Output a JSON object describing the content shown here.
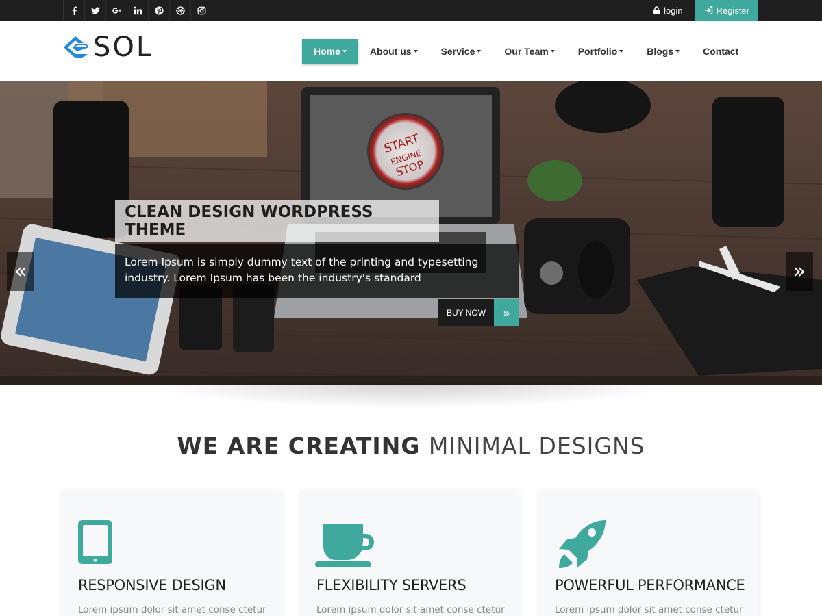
{
  "colors": {
    "accent": "#40a99d",
    "topbar": "#1f1f1f",
    "logo_blue": "#1e88e5"
  },
  "topbar": {
    "social": [
      {
        "name": "facebook-icon",
        "glyph": "f"
      },
      {
        "name": "twitter-icon",
        "glyph": "t"
      },
      {
        "name": "google-plus-icon",
        "glyph": "G+"
      },
      {
        "name": "linkedin-icon",
        "glyph": "in"
      },
      {
        "name": "pinterest-icon",
        "glyph": "p"
      },
      {
        "name": "dribbble-icon",
        "glyph": "d"
      },
      {
        "name": "instagram-icon",
        "glyph": "ig"
      }
    ],
    "login_label": "login",
    "register_label": "Register"
  },
  "header": {
    "logo_text": "SOL",
    "nav": [
      {
        "label": "Home",
        "dropdown": true,
        "active": true
      },
      {
        "label": "About us",
        "dropdown": true,
        "active": false
      },
      {
        "label": "Service",
        "dropdown": true,
        "active": false
      },
      {
        "label": "Our Team",
        "dropdown": true,
        "active": false
      },
      {
        "label": "Portfolio",
        "dropdown": true,
        "active": false
      },
      {
        "label": "Blogs",
        "dropdown": true,
        "active": false
      },
      {
        "label": "Contact",
        "dropdown": false,
        "active": false
      }
    ]
  },
  "hero": {
    "title": "CLEAN DESIGN WORDPRESS THEME",
    "text": "Lorem Ipsum is simply dummy text of the printing and typesetting industry. Lorem Ipsum has been the industry's standard",
    "button_label": "BUY NOW",
    "screen_text_1": "START",
    "screen_text_2": "ENGINE",
    "screen_text_3": "STOP"
  },
  "section": {
    "title_bold": "WE ARE CREATING",
    "title_light": "MINIMAL DESIGNS"
  },
  "features": [
    {
      "icon": "tablet-icon",
      "title": "RESPONSIVE DESIGN",
      "text": "Lorem ipsum dolor sit amet conse ctetur"
    },
    {
      "icon": "coffee-cup-icon",
      "title": "FLEXIBILITY SERVERS",
      "text": "Lorem ipsum dolor sit amet conse ctetur"
    },
    {
      "icon": "rocket-icon",
      "title": "POWERFUL PERFORMANCE",
      "text": "Lorem ipsum dolor sit amet conse ctetur"
    }
  ]
}
